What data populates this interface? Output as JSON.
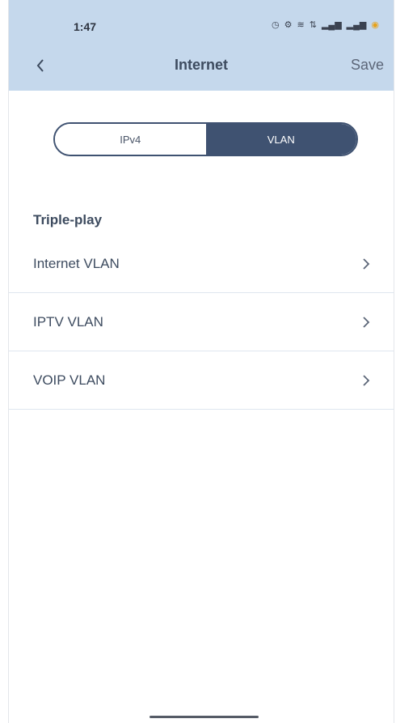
{
  "status_bar": {
    "time": "1:47",
    "icons": [
      "alarm-icon",
      "vpn-icon",
      "wifi-icon",
      "data-icon",
      "signal-icon",
      "signal-icon",
      "battery-icon"
    ]
  },
  "header": {
    "title": "Internet",
    "save_label": "Save",
    "background": "#c5d8ec"
  },
  "tabs": {
    "items": [
      "IPv4",
      "VLAN"
    ],
    "selected": "VLAN",
    "accent": "#3f5271"
  },
  "section": {
    "heading": "Triple-play",
    "items": [
      {
        "label": "Internet VLAN"
      },
      {
        "label": "IPTV VLAN"
      },
      {
        "label": "VOIP VLAN"
      }
    ]
  }
}
